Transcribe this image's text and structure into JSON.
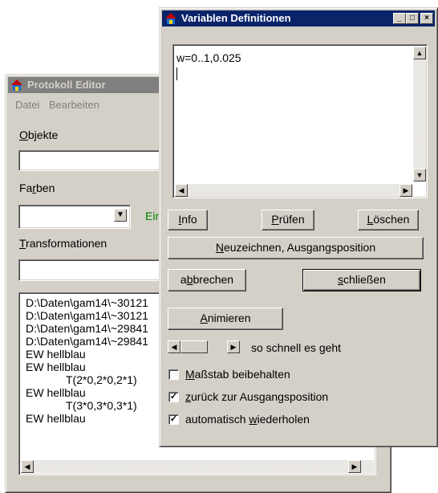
{
  "protokoll": {
    "title": "Protokoll Editor",
    "menu": [
      "Datei",
      "Bearbeiten"
    ],
    "objekte_label": "Objekte",
    "farben_label": "Farben",
    "farben_side_text": "Ein",
    "transformationen_label": "Transformationen",
    "list_items": [
      "D:\\Daten\\gam14\\~30121",
      "D:\\Daten\\gam14\\~30121",
      "D:\\Daten\\gam14\\~29841",
      "D:\\Daten\\gam14\\~29841",
      "EW hellblau",
      "EW hellblau",
      "T(2*0,2*0,2*1)",
      "EW hellblau",
      "T(3*0,3*0,3*1)",
      "EW hellblau"
    ]
  },
  "variablen": {
    "title": "Variablen Definitionen",
    "editor_text": "w=0..1,0.025",
    "info_label": "Info",
    "pruefen_label": "Prüfen",
    "loeschen_label": "Löschen",
    "neuzeichnen_label": "Neuzeichnen, Ausgangsposition",
    "abbrechen_label": "abbrechen",
    "schliessen_label": "schließen",
    "animieren_label": "Animieren",
    "speed_text": "so schnell es geht",
    "check_massstab": "Maßstab beibehalten",
    "check_zurueck": "zurück zur Ausgangsposition",
    "check_auto": "automatisch wiederholen",
    "check_states": [
      false,
      true,
      true
    ]
  },
  "colors": {
    "titlebar_active": "#0a246a",
    "titlebar_inactive": "#808080",
    "face": "#d4d0c8",
    "side_text_green": "#008000"
  }
}
